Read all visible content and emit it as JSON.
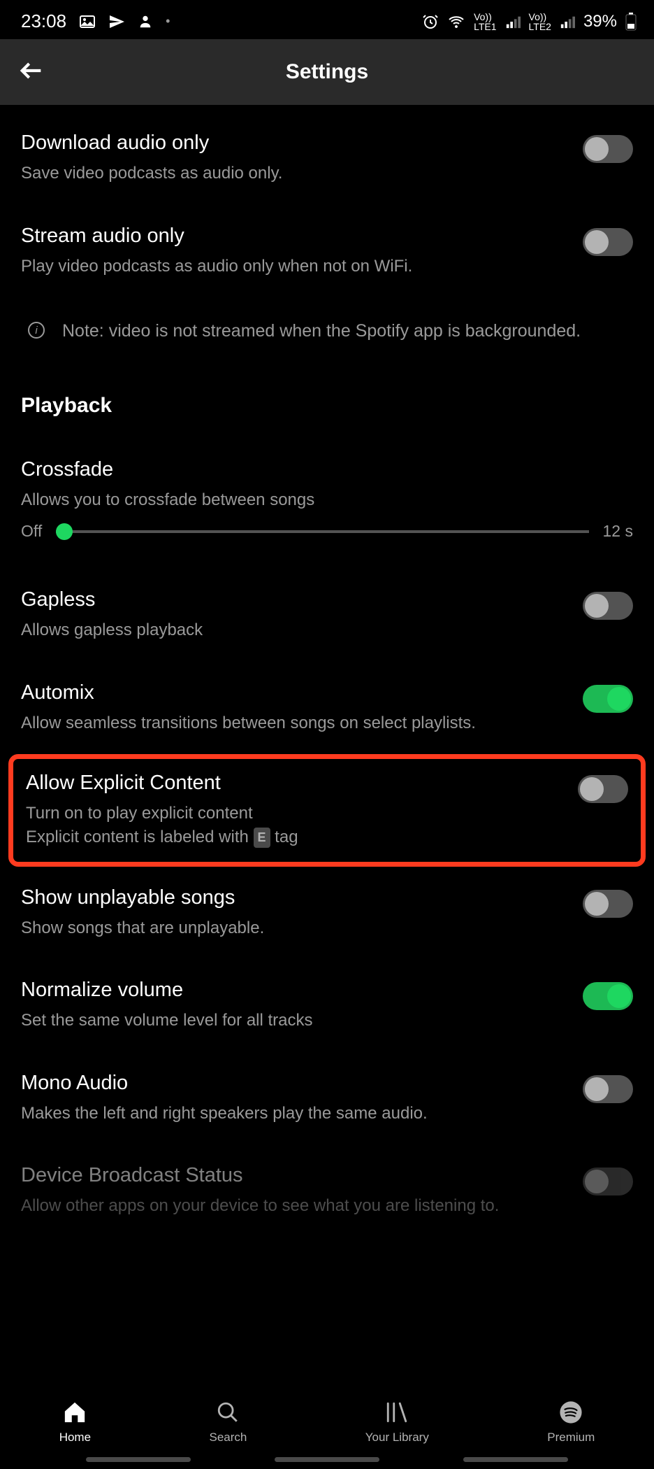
{
  "status_bar": {
    "time": "23:08",
    "battery": "39%",
    "lte1": "LTE1",
    "lte2": "LTE2",
    "vo1": "Vo))",
    "vo2": "Vo))"
  },
  "header": {
    "title": "Settings"
  },
  "settings": {
    "download_audio": {
      "title": "Download audio only",
      "subtitle": "Save video podcasts as audio only."
    },
    "stream_audio": {
      "title": "Stream audio only",
      "subtitle": "Play video podcasts as audio only when not on WiFi."
    },
    "note": "Note: video is not streamed when the Spotify app is backgrounded.",
    "playback_header": "Playback",
    "crossfade": {
      "title": "Crossfade",
      "subtitle": "Allows you to crossfade between songs",
      "off_label": "Off",
      "max_label": "12 s"
    },
    "gapless": {
      "title": "Gapless",
      "subtitle": "Allows gapless playback"
    },
    "automix": {
      "title": "Automix",
      "subtitle": "Allow seamless transitions between songs on select playlists."
    },
    "explicit": {
      "title": "Allow Explicit Content",
      "subtitle1": "Turn on to play explicit content",
      "subtitle2a": "Explicit content is labeled with ",
      "subtitle2b": " tag",
      "e_label": "E"
    },
    "unplayable": {
      "title": "Show unplayable songs",
      "subtitle": "Show songs that are unplayable."
    },
    "normalize": {
      "title": "Normalize volume",
      "subtitle": "Set the same volume level for all tracks"
    },
    "mono": {
      "title": "Mono Audio",
      "subtitle": "Makes the left and right speakers play the same audio."
    },
    "broadcast": {
      "title": "Device Broadcast Status",
      "subtitle": "Allow other apps on your device to see what you are listening to."
    }
  },
  "nav": {
    "home": "Home",
    "search": "Search",
    "library": "Your Library",
    "premium": "Premium"
  }
}
